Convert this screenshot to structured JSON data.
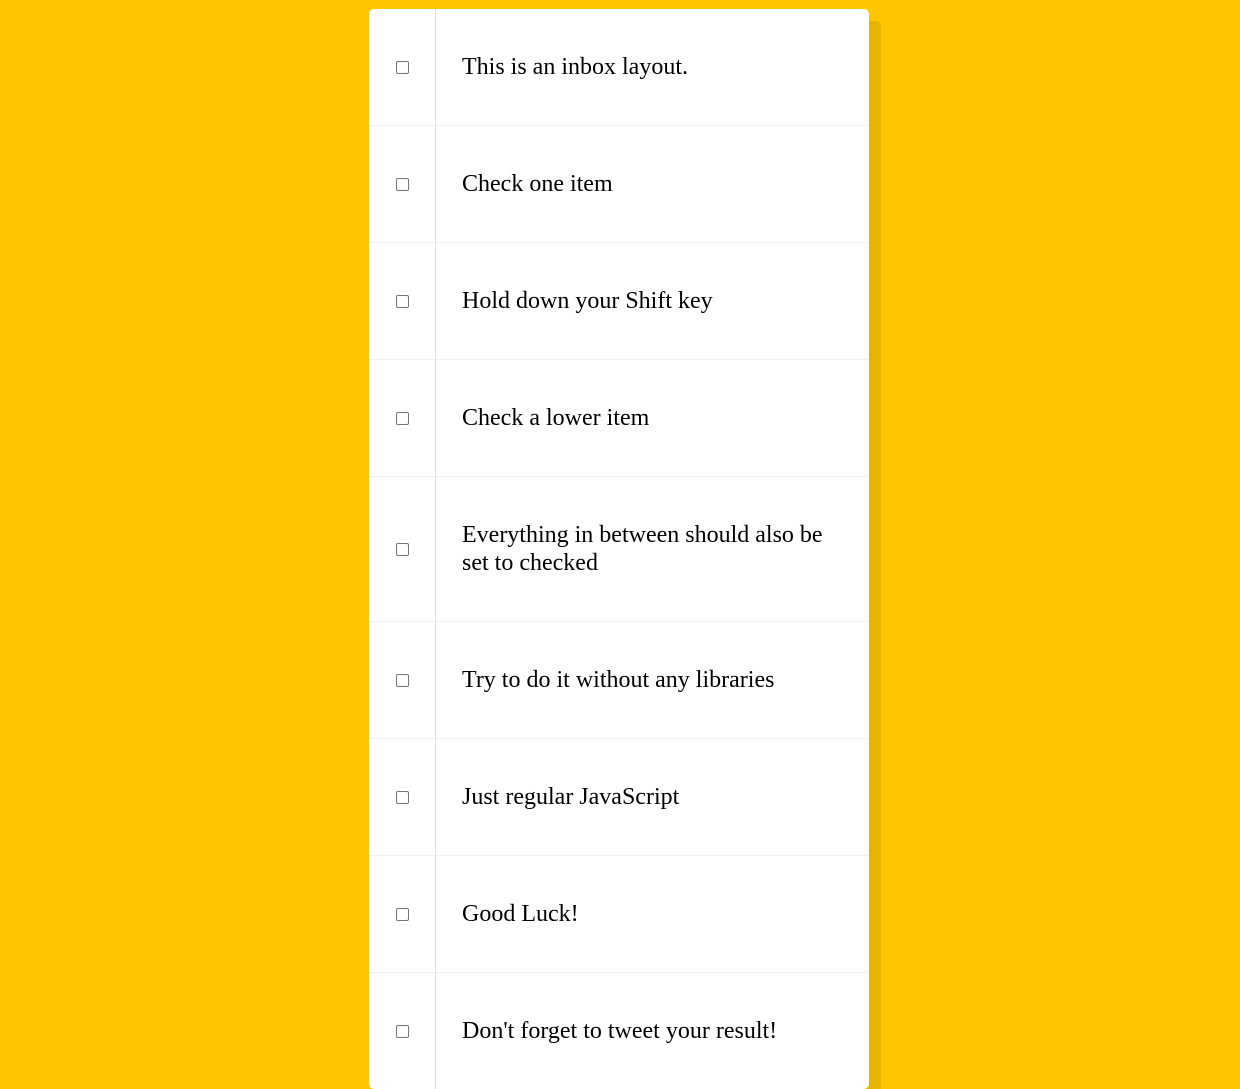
{
  "colors": {
    "background": "#ffc600",
    "panel": "#ffffff"
  },
  "items": [
    {
      "text": "This is an inbox layout.",
      "checked": false
    },
    {
      "text": "Check one item",
      "checked": false
    },
    {
      "text": "Hold down your Shift key",
      "checked": false
    },
    {
      "text": "Check a lower item",
      "checked": false
    },
    {
      "text": "Everything in between should also be set to checked",
      "checked": false
    },
    {
      "text": "Try to do it without any libraries",
      "checked": false
    },
    {
      "text": "Just regular JavaScript",
      "checked": false
    },
    {
      "text": "Good Luck!",
      "checked": false
    },
    {
      "text": "Don't forget to tweet your result!",
      "checked": false
    }
  ]
}
